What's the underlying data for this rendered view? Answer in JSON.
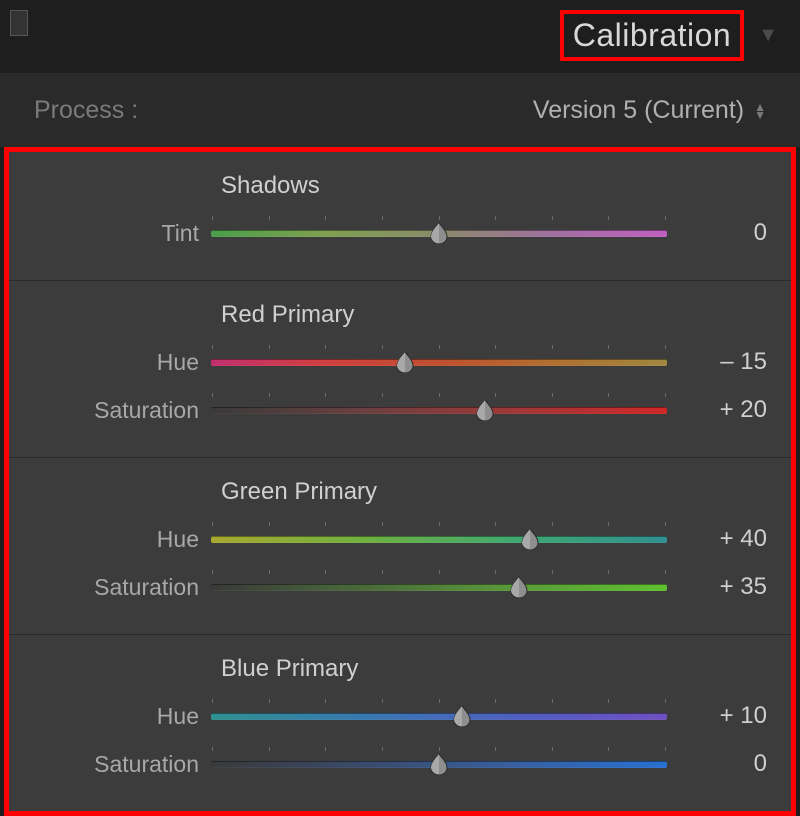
{
  "panel_title": "Calibration",
  "process": {
    "label": "Process :",
    "value": "Version 5 (Current)"
  },
  "groups": {
    "shadows": {
      "title": "Shadows",
      "tint": {
        "label": "Tint",
        "value": "0",
        "pos": 50
      }
    },
    "red": {
      "title": "Red Primary",
      "hue": {
        "label": "Hue",
        "value": "– 15",
        "pos": 42.5
      },
      "sat": {
        "label": "Saturation",
        "value": "+ 20",
        "pos": 60
      }
    },
    "green": {
      "title": "Green Primary",
      "hue": {
        "label": "Hue",
        "value": "+ 40",
        "pos": 70
      },
      "sat": {
        "label": "Saturation",
        "value": "+ 35",
        "pos": 67.5
      }
    },
    "blue": {
      "title": "Blue Primary",
      "hue": {
        "label": "Hue",
        "value": "+ 10",
        "pos": 55
      },
      "sat": {
        "label": "Saturation",
        "value": "0",
        "pos": 50
      }
    }
  }
}
